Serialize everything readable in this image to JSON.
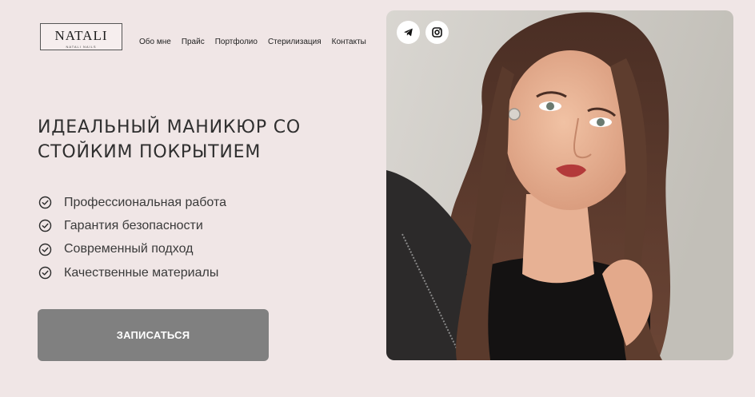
{
  "header": {
    "logo": {
      "title": "NATALI",
      "subtitle": "NATALI NAILS"
    },
    "nav": [
      "Обо мне",
      "Прайс",
      "Портфолио",
      "Стерилизация",
      "Контакты"
    ]
  },
  "hero": {
    "title_line1": "ИДЕАЛЬНЫЙ МАНИКЮР СО",
    "title_line2": "СТОЙКИМ ПОКРЫТИЕМ",
    "features": [
      "Профессиональная работа",
      "Гарантия безопасности",
      "Современный подход",
      "Качественные материалы"
    ],
    "cta_label": "ЗАПИСАТЬСЯ"
  },
  "social": [
    "telegram-icon",
    "instagram-icon"
  ],
  "colors": {
    "background": "#f0e6e6",
    "button": "#808080",
    "text": "#2f2f2f"
  }
}
